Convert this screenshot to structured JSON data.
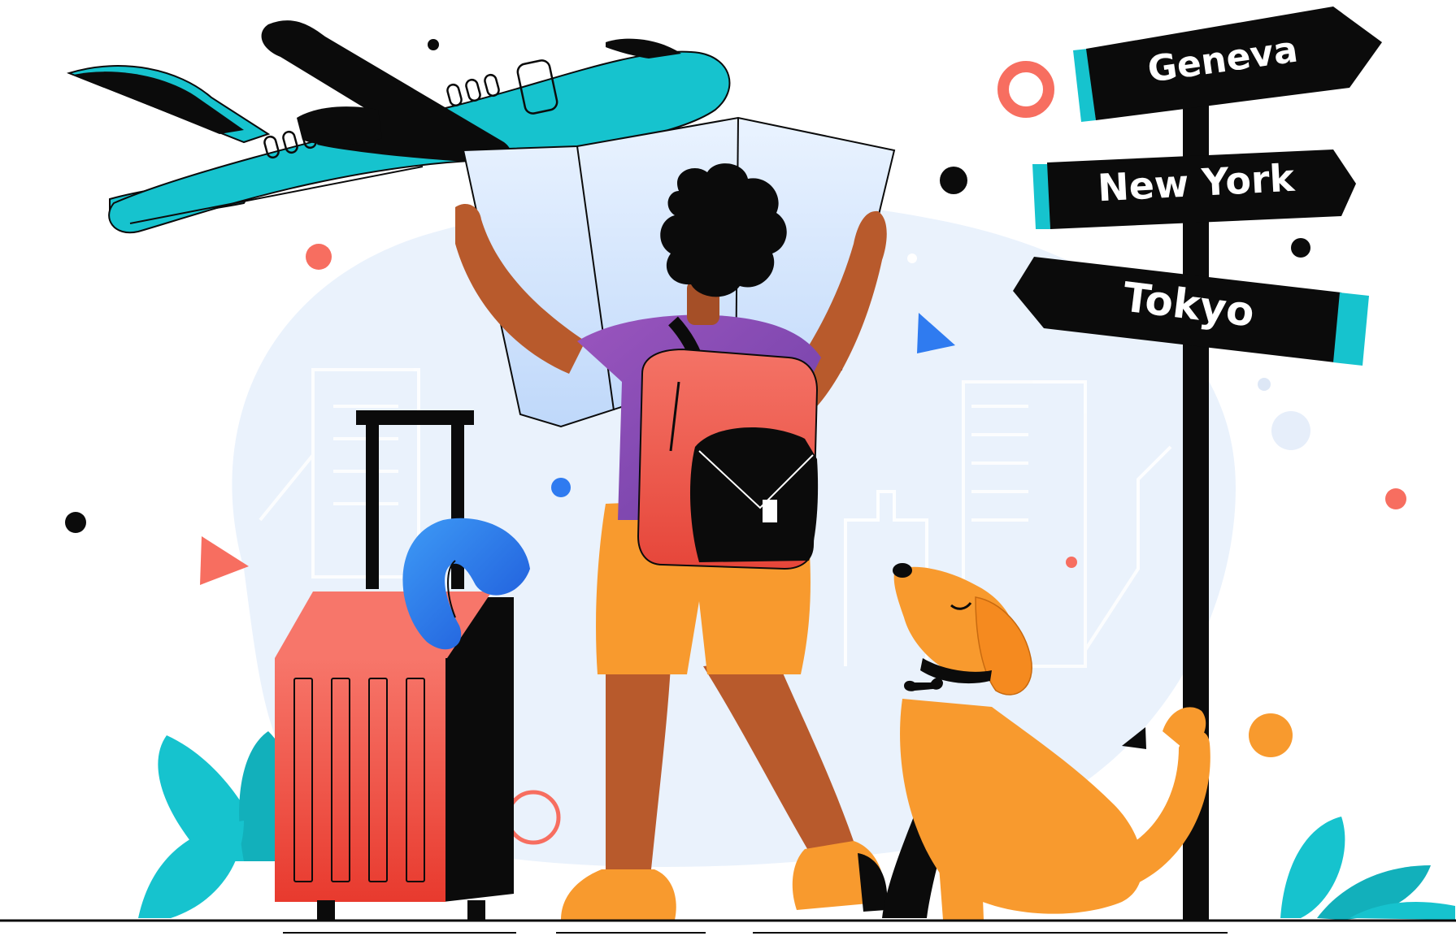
{
  "signpost": {
    "geneva": "Geneva",
    "new_york": "New York",
    "tokyo": "Tokyo"
  },
  "colors": {
    "teal": "#16C3CE",
    "coral": "#F2594B",
    "orange": "#F89A2E",
    "blue": "#2F7BF0",
    "purple": "#8B4BB0",
    "skin": "#B85A2C",
    "bg_blob": "#EAF2FC",
    "black": "#0B0B0B"
  },
  "icons": [
    "airplane-icon",
    "signpost-icon",
    "suitcase-icon",
    "dog-icon",
    "traveler-icon",
    "map-icon"
  ]
}
